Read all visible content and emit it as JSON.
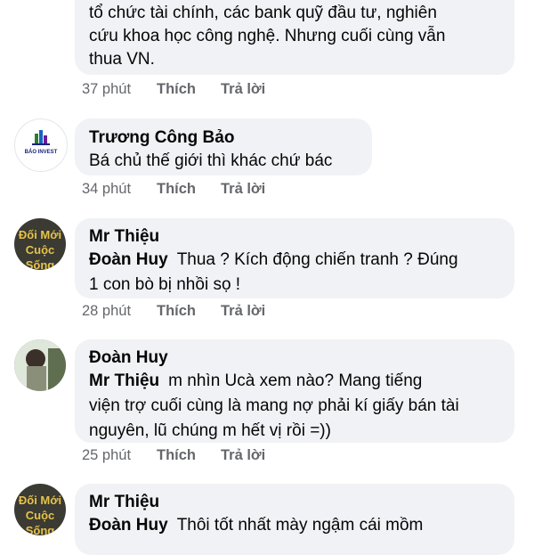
{
  "comments": [
    {
      "name": "",
      "lines": [
        "tổ chức tài chính, các bank quỹ đầu tư, nghiên",
        "cứu khoa học công nghệ. Nhưng cuối cùng vẫn",
        "thua VN."
      ],
      "time": "37 phút",
      "like": "Thích",
      "reply": "Trả lời"
    },
    {
      "name": "Trương Công Bảo",
      "avatar_text": "BẢO INVEST",
      "lines": [
        "Bá chủ thế giới thì khác chứ bác"
      ],
      "time": "34 phút",
      "like": "Thích",
      "reply": "Trả lời"
    },
    {
      "name": "Mr Thiệu",
      "avatar_text": "Đối Mới Cuộc Sống",
      "tag": "Đoàn Huy",
      "lines": [
        "Thua ? Kích động chiến tranh ? Đúng",
        "1 con bò bị nhồi sọ !"
      ],
      "time": "28 phút",
      "like": "Thích",
      "reply": "Trả lời"
    },
    {
      "name": "Đoàn Huy",
      "tag": "Mr Thiệu",
      "lines": [
        "m nhìn Ucà xem nào? Mang tiếng",
        "viện trợ cuối cùng là mang nợ phải kí giấy bán tài",
        "nguyên, lũ chúng m hết vị rồi =))"
      ],
      "time": "25 phút",
      "like": "Thích",
      "reply": "Trả lời"
    },
    {
      "name": "Mr Thiệu",
      "avatar_text": "Đối Mới Cuộc Sống",
      "tag": "Đoàn Huy",
      "lines": [
        "Thôi tốt nhất mày ngậm cái mồm"
      ]
    }
  ]
}
